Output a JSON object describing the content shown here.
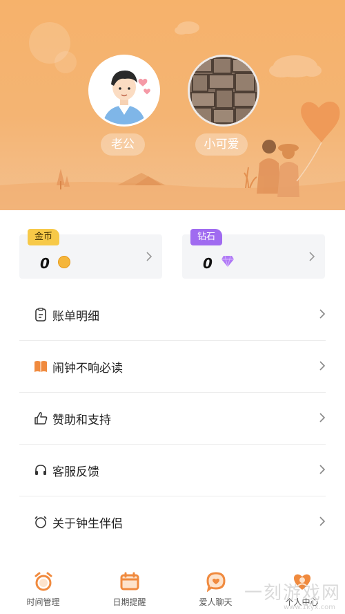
{
  "profile": {
    "left_name": "老公",
    "right_name": "小可爱"
  },
  "wallet": {
    "gold": {
      "tag": "金币",
      "value": "0",
      "icon": "coin-icon",
      "tag_color": "#f7c948"
    },
    "diamond": {
      "tag": "钻石",
      "value": "0",
      "icon": "diamond-icon",
      "tag_color": "#a06bf0"
    }
  },
  "menu": {
    "items": [
      {
        "label": "账单明细",
        "icon": "clipboard-icon"
      },
      {
        "label": "闹钟不响必读",
        "icon": "book-icon"
      },
      {
        "label": "赞助和支持",
        "icon": "thumbs-up-icon"
      },
      {
        "label": "客服反馈",
        "icon": "headset-icon"
      },
      {
        "label": "关于钟生伴侣",
        "icon": "alarm-clock-icon"
      }
    ]
  },
  "bottom_nav": {
    "items": [
      {
        "label": "时间管理",
        "icon": "alarm-clock-icon"
      },
      {
        "label": "日期提醒",
        "icon": "calendar-icon"
      },
      {
        "label": "爱人聊天",
        "icon": "chat-bubble-icon"
      },
      {
        "label": "个人中心",
        "icon": "heart-user-icon"
      }
    ]
  },
  "watermark": {
    "text": "一刻游戏网",
    "url": "www.1kyx.com"
  },
  "colors": {
    "header_top": "#f6b26b",
    "header_bottom": "#f3c08e",
    "accent_orange": "#f08a3e"
  }
}
